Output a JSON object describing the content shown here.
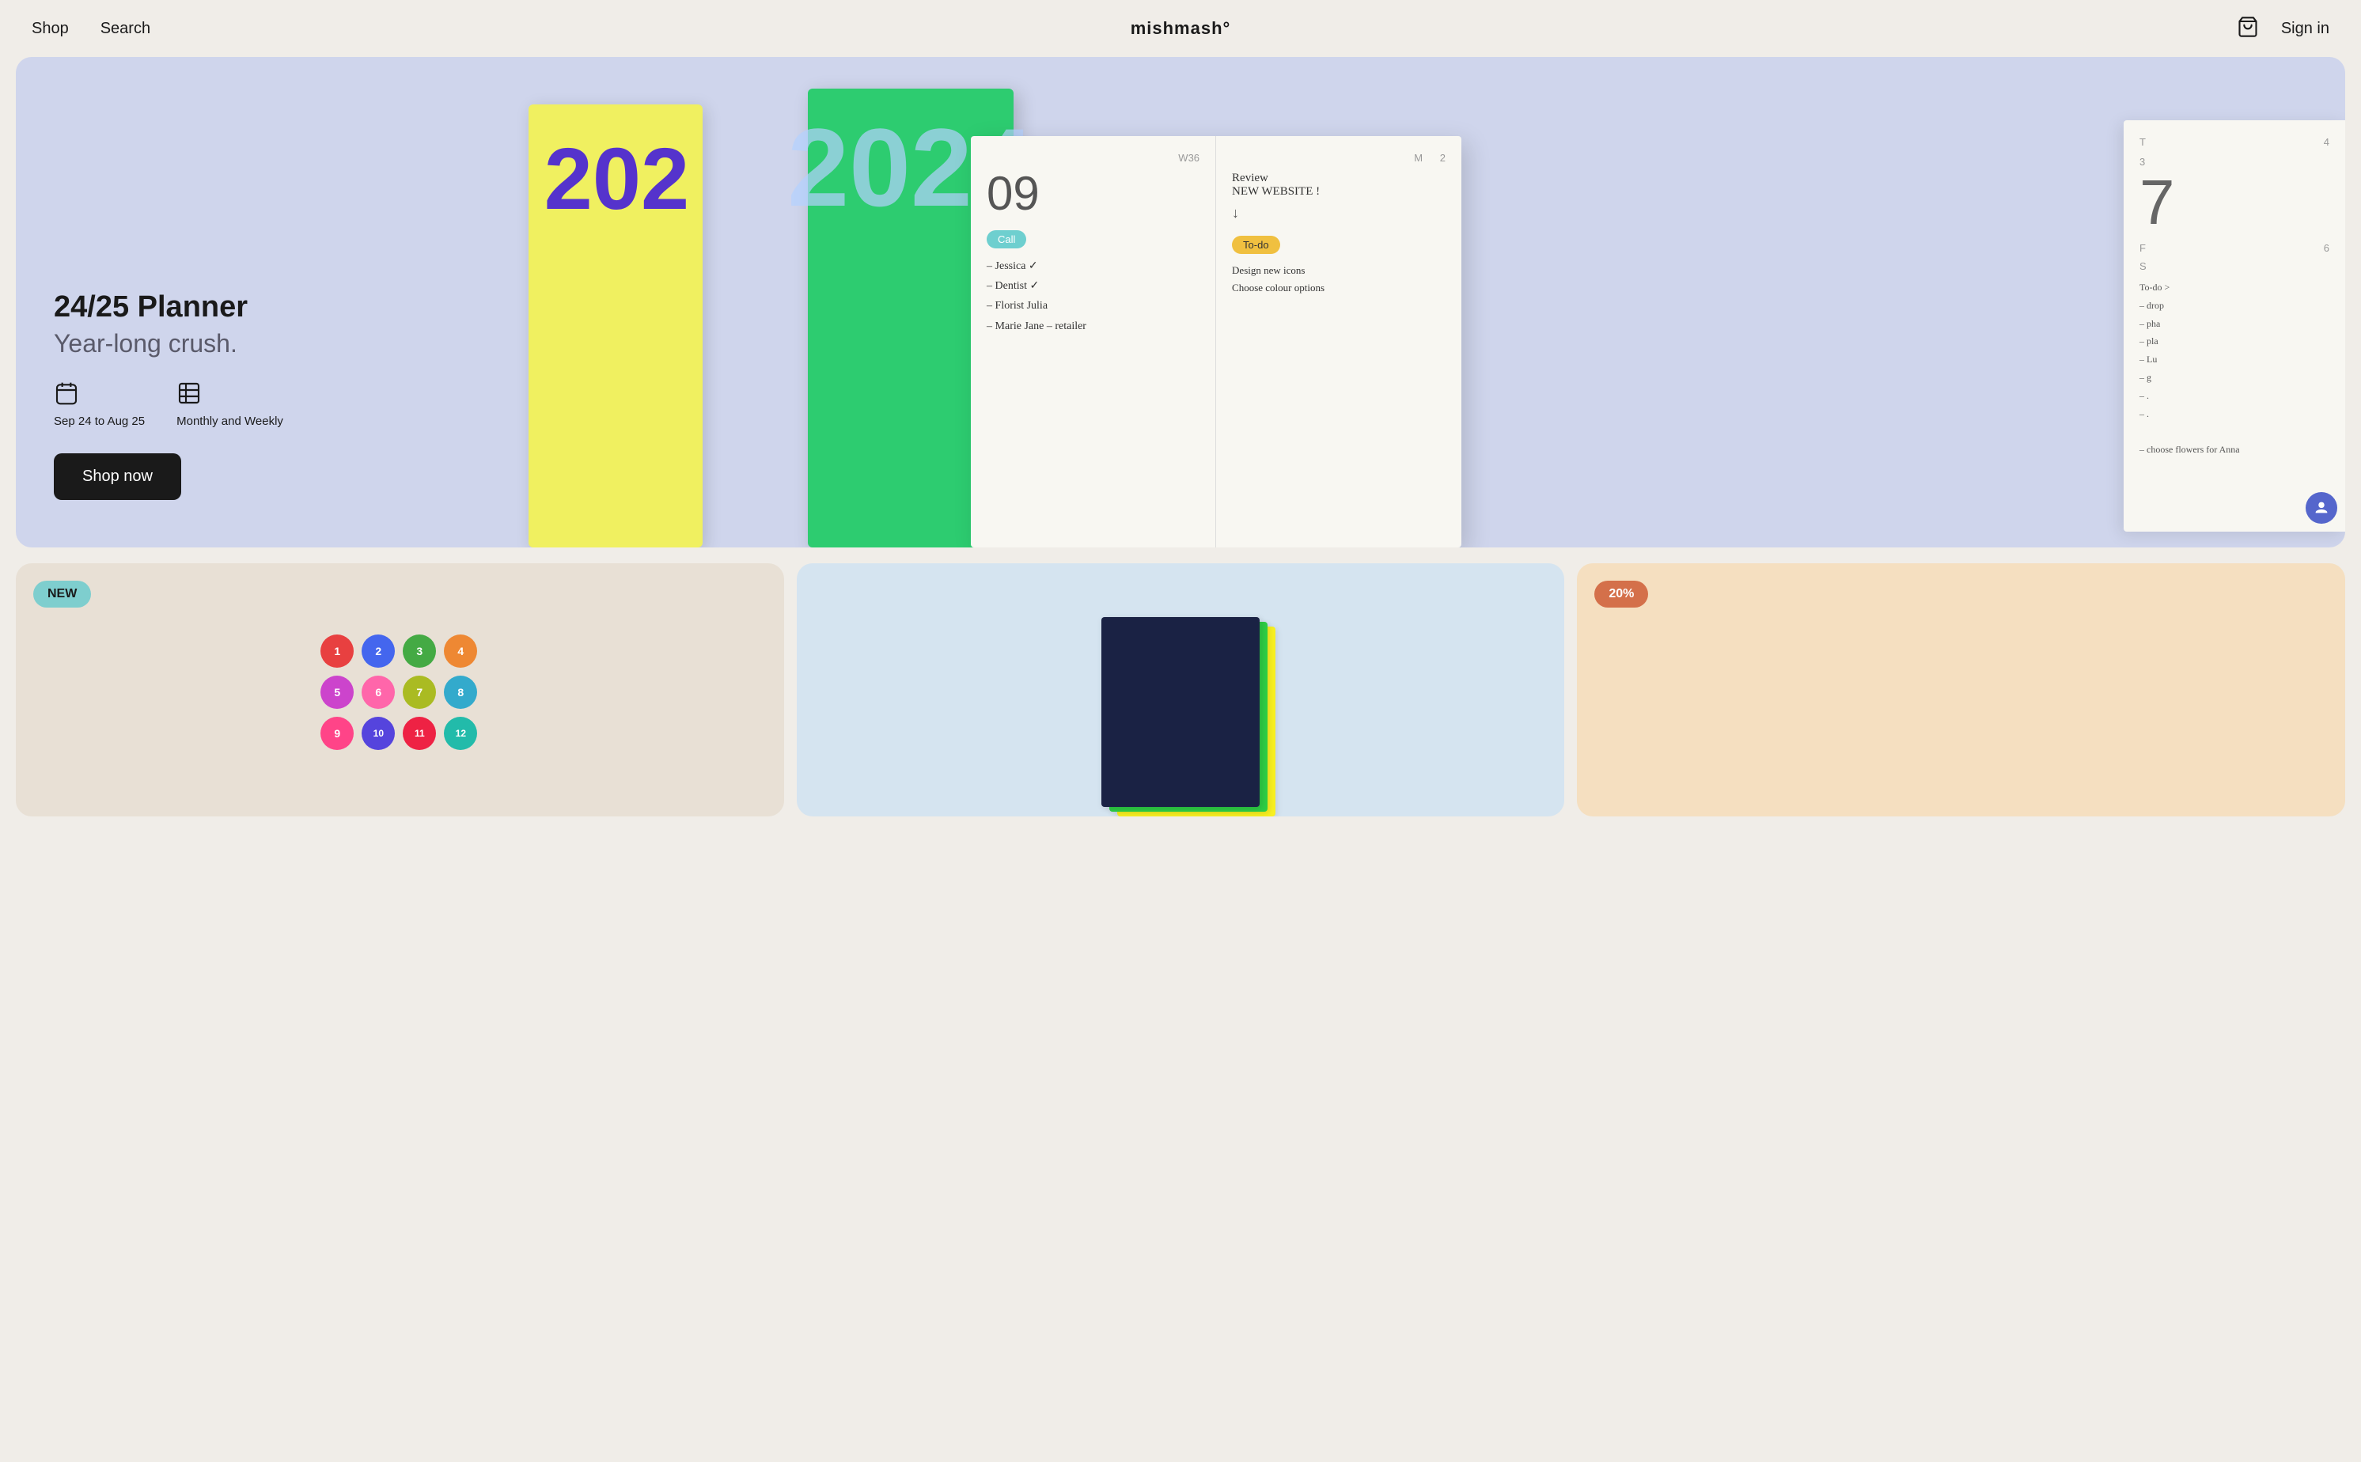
{
  "nav": {
    "shop_label": "Shop",
    "search_label": "Search",
    "logo": "mishmash°",
    "signin_label": "Sign in"
  },
  "hero": {
    "title": "24/25 Planner",
    "subtitle": "Year-long crush.",
    "meta_date": "Sep 24 to Aug 25",
    "meta_format": "Monthly and Weekly",
    "shop_now_label": "Shop now",
    "bg_color": "#cfd5ec",
    "planner_year_text": "202",
    "planner_year_full": "2024"
  },
  "cards": [
    {
      "badge": "NEW",
      "badge_type": "new",
      "bg": "#e8e0d5"
    },
    {
      "bg": "#d5e4f0"
    },
    {
      "badge": "20%",
      "badge_type": "discount",
      "bg": "#f5dfc0"
    }
  ],
  "icons": {
    "calendar_icon": "📅",
    "list_icon": "📋",
    "cart": "cart-icon",
    "shield": "shield-icon"
  }
}
